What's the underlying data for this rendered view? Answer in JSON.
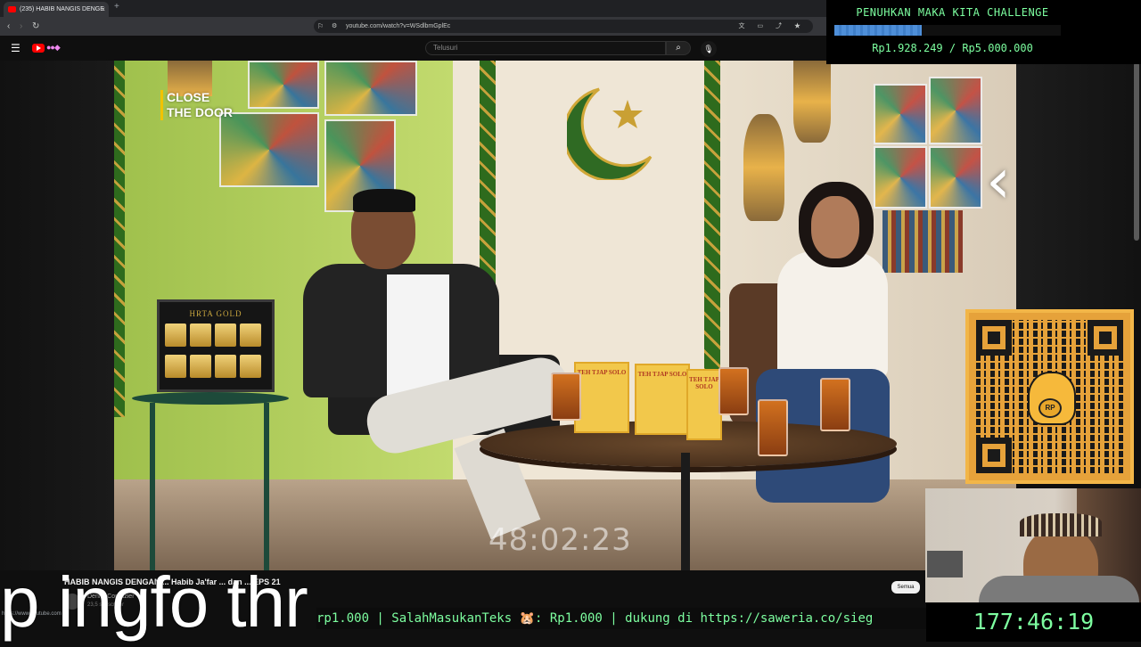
{
  "browser": {
    "tab_title": "(235) HABIB NANGIS DENGE",
    "tab_close": "×",
    "new_tab": "+",
    "back": "‹",
    "forward": "›",
    "reload": "↻",
    "url": "youtube.com/watch?v=WSdlbmGplEc"
  },
  "youtube": {
    "search_placeholder": "Telusuri",
    "video_title": "HABIB NANGIS DENGAN ... Habib Ja'far ... dan ... EPS 21",
    "channel_name": "Denny Corbuzier",
    "subscribers": "23,5 subscriber",
    "filter_all": "Semua",
    "status_url": "https://www.youtube.com"
  },
  "video": {
    "overlay_label": "CLOSE THE DOOR",
    "overlay_line1": "CLOSE",
    "overlay_line2": "THE DOOR",
    "sponsor_logo": "HRTA GOLD",
    "product_label": "TEH TJAP SOLO",
    "timestamp_overlay": "48:02:23"
  },
  "challenge": {
    "title": "PENUHKAN MAKA KITA CHALLENGE",
    "progress_fraction": 0.3856,
    "amount": "Rp1.928.249 / Rp5.000.000",
    "bar_color": "#4e8fd9",
    "text_color": "#7dffa0"
  },
  "qr": {
    "badge": "RP"
  },
  "stream": {
    "caption": "p ingfo thr",
    "ticker": "rp1.000 | SalahMasukanTeks 🐹: Rp1.000 |  dukung di https://saweria.co/sieg",
    "clock": "177:46:19"
  }
}
